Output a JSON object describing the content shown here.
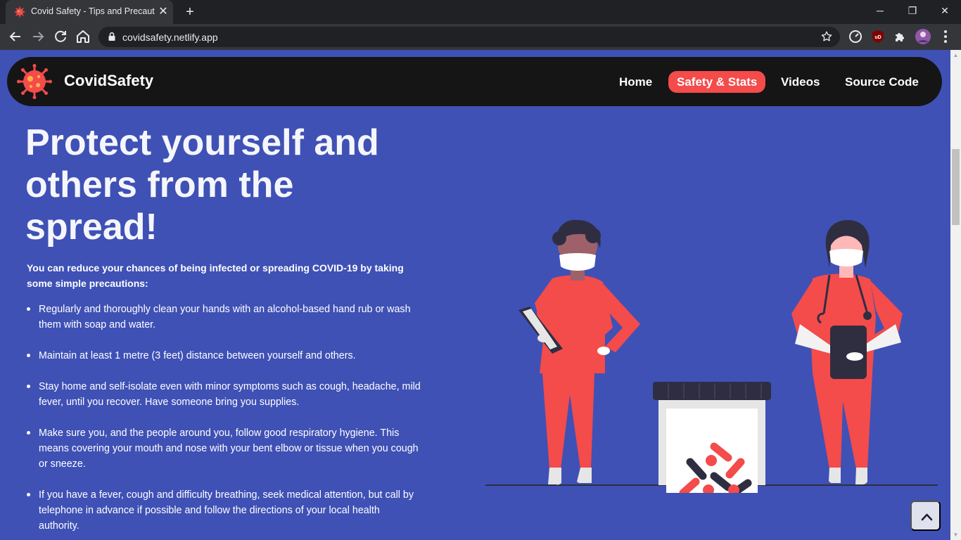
{
  "browser": {
    "tab_title": "Covid Safety - Tips and Precautions",
    "url": "covidsafety.netlify.app"
  },
  "navbar": {
    "brand": "CovidSafety",
    "links": [
      {
        "label": "Home",
        "active": false
      },
      {
        "label": "Safety & Stats",
        "active": true
      },
      {
        "label": "Videos",
        "active": false
      },
      {
        "label": "Source Code",
        "active": false
      }
    ]
  },
  "hero": {
    "title": "Protect yourself and others from the spread!",
    "intro": "You can reduce your chances of being infected or spreading COVID-19 by taking some simple precautions:",
    "tips": [
      "Regularly and thoroughly clean your hands with an alcohol-based hand rub or wash them with soap and water.",
      "Maintain at least 1 metre (3 feet) distance between yourself and others.",
      "Stay home and self-isolate even with minor symptoms such as cough, headache, mild fever, until you recover. Have someone bring you supplies.",
      "Make sure you, and the people around you, follow good respiratory hygiene. This means covering your mouth and nose with your bent elbow or tissue when you cough or sneeze.",
      "If you have a fever, cough and difficulty breathing, seek medical attention, but call by telephone in advance if possible and follow the directions of your local health authority."
    ]
  },
  "icons": {
    "back": "arrow-left-icon",
    "forward": "arrow-right-icon",
    "reload": "reload-icon",
    "home": "home-icon",
    "lock": "lock-icon",
    "bookmark": "star-icon",
    "back_to_top": "chevron-up-icon",
    "logo": "virus-icon"
  },
  "colors": {
    "page_background": "#3f51b5",
    "navbar_background": "#151515",
    "accent": "#f44b4b"
  }
}
